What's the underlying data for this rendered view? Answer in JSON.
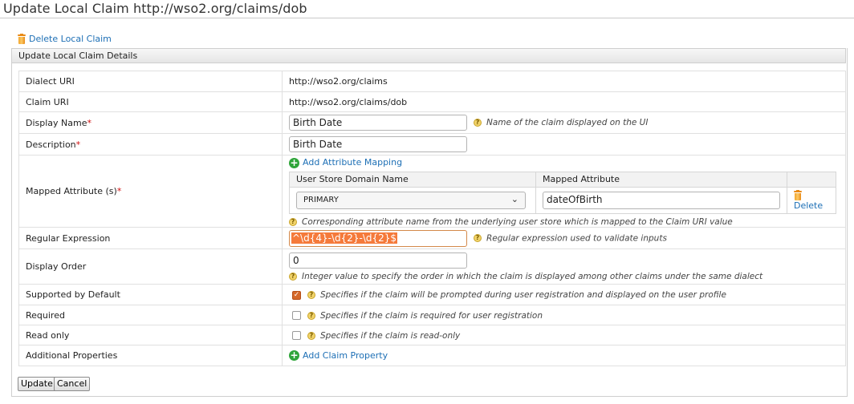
{
  "page": {
    "title": "Update Local Claim http://wso2.org/claims/dob"
  },
  "actions": {
    "delete_claim": "Delete Local Claim"
  },
  "section": {
    "header": "Update Local Claim Details"
  },
  "form": {
    "dialect_uri": {
      "label": "Dialect URI",
      "value": "http://wso2.org/claims"
    },
    "claim_uri": {
      "label": "Claim URI",
      "value": "http://wso2.org/claims/dob"
    },
    "display_name": {
      "label": "Display Name",
      "required": "*",
      "value": "Birth Date",
      "hint": "Name of the claim displayed on the UI"
    },
    "description": {
      "label": "Description",
      "required": "*",
      "value": "Birth Date"
    },
    "mapped_attributes": {
      "label": "Mapped Attribute (s)",
      "required": "*",
      "add_label": "Add Attribute Mapping",
      "columns": [
        "User Store Domain Name",
        "Mapped Attribute"
      ],
      "rows": [
        {
          "domain": "PRIMARY",
          "attribute": "dateOfBirth",
          "delete_label": "Delete"
        }
      ],
      "hint": "Corresponding attribute name from the underlying user store which is mapped to the Claim URI value"
    },
    "regex": {
      "label": "Regular Expression",
      "value": "^\\d{4}-\\d{2}-\\d{2}$",
      "hint": "Regular expression used to validate inputs"
    },
    "display_order": {
      "label": "Display Order",
      "value": "0",
      "hint": "Integer value to specify the order in which the claim is displayed among other claims under the same dialect"
    },
    "supported_by_default": {
      "label": "Supported by Default",
      "checked": true,
      "hint": "Specifies if the claim will be prompted during user registration and displayed on the user profile"
    },
    "required": {
      "label": "Required",
      "checked": false,
      "hint": "Specifies if the claim is required for user registration"
    },
    "read_only": {
      "label": "Read only",
      "checked": false,
      "hint": "Specifies if the claim is read-only"
    },
    "additional_properties": {
      "label": "Additional Properties",
      "add_label": "Add Claim Property"
    }
  },
  "buttons": {
    "update": "Update",
    "cancel": "Cancel"
  },
  "colors": {
    "link": "#1d6fb5",
    "required_star": "#d01010",
    "add_icon": "#2fa53a",
    "checkbox_checked": "#d5692b",
    "regex_highlight": "#f57a3b"
  }
}
